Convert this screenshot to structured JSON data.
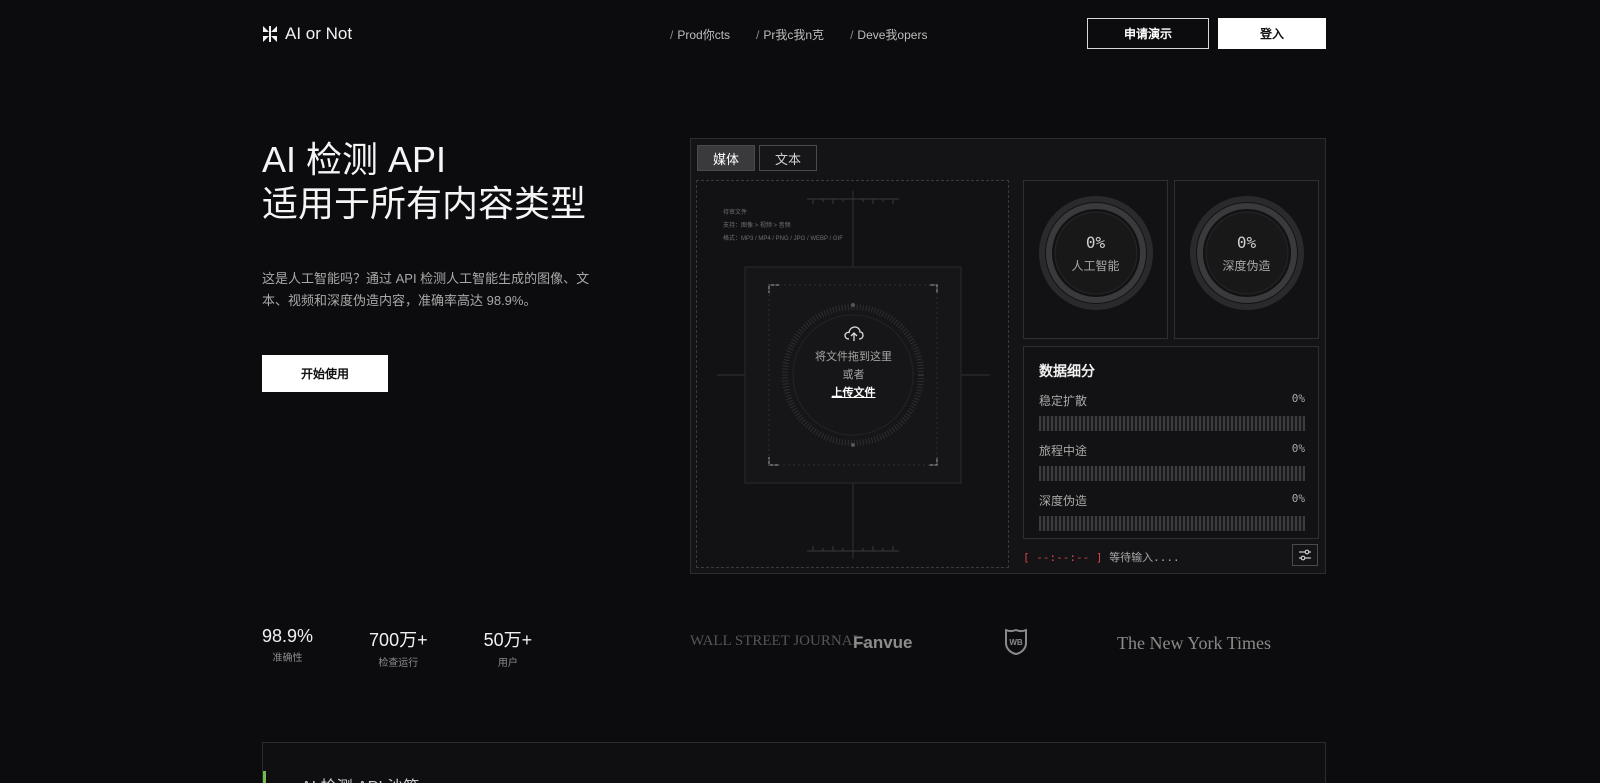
{
  "nav": {
    "brand": "AI or Not",
    "links": [
      "Prod你cts",
      "Pr我c我n克",
      "Deve我opers"
    ],
    "demo_label": "申请演示",
    "login_label": "登入"
  },
  "hero": {
    "title_line1": "AI 检测 API",
    "title_line2": "适用于所有内容类型",
    "description": "这是人工智能吗？通过 API 检测人工智能生成的图像、文本、视频和深度伪造内容，准确率高达 98.9%。",
    "start_label": "开始使用"
  },
  "stats": [
    {
      "value": "98.9%",
      "label": "准确性"
    },
    {
      "value": "700万+",
      "label": "检查运行"
    },
    {
      "value": "50万+",
      "label": "用户"
    }
  ],
  "logos": {
    "wsj": "WALL STREET JOURNAL.",
    "fanvue": "Fanvue",
    "wb": "WB",
    "nyt": "The New York Times"
  },
  "widget": {
    "tabs": [
      "媒体",
      "文本"
    ],
    "active_tab": "媒体",
    "dropzone": {
      "info_line1": "待审文件",
      "info_line2": "支持：图像 > 视频 > 音频",
      "info_line3": "格式：MP3 / MP4 / PNG / JPG / WEBP / GIF",
      "drag_text": "将文件拖到这里",
      "or_text": "或者",
      "upload_text": "上传文件"
    },
    "gauges": [
      {
        "value": "0%",
        "label": "人工智能",
        "fraction": 0
      },
      {
        "value": "0%",
        "label": "深度伪造",
        "fraction": 0
      }
    ],
    "breakdown": {
      "title": "数据细分",
      "rows": [
        {
          "name": "稳定扩散",
          "pct": "0%"
        },
        {
          "name": "旅程中途",
          "pct": "0%"
        },
        {
          "name": "深度伪造",
          "pct": "0%"
        }
      ]
    },
    "status": {
      "time": "--:--:--",
      "text": "等待输入....",
      "open_bracket": "[",
      "close_bracket": "]"
    }
  },
  "sandbox": {
    "title": "AI 检测 API 沙箱"
  },
  "colors": {
    "background": "#0c0c0e",
    "accent_green": "#6fbf4f",
    "status_red": "#d14747"
  }
}
